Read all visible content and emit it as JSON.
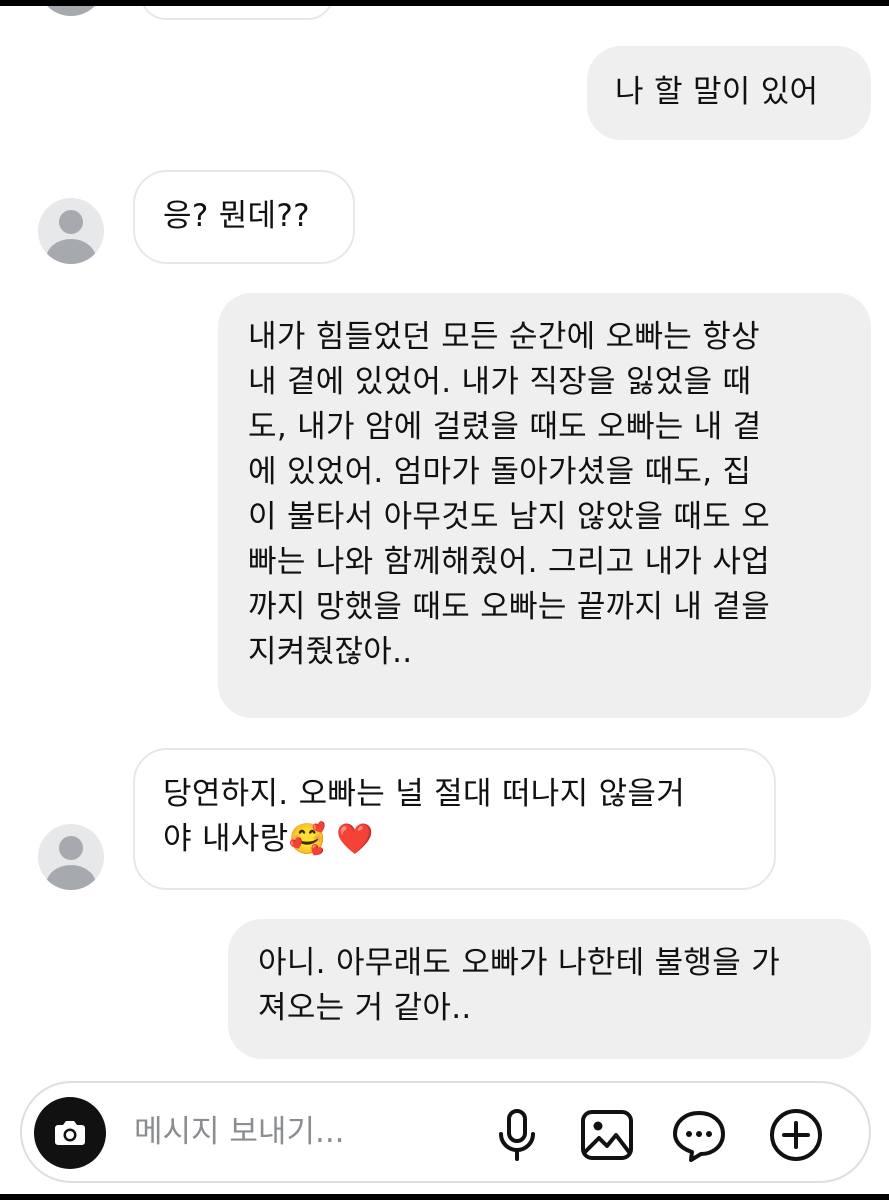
{
  "messages": [
    {
      "from": "me",
      "lines": [
        "나 할 말이 있어"
      ]
    },
    {
      "from": "them",
      "lines": [
        "응? 뭔데??"
      ]
    },
    {
      "from": "me",
      "lines": [
        "내가 힘들었던 모든 순간에 오빠는 항상",
        "내 곁에 있었어. 내가 직장을 잃었을 때",
        "도, 내가 암에 걸렸을 때도 오빠는 내 곁",
        "에 있었어. 엄마가 돌아가셨을 때도, 집",
        "이 불타서 아무것도 남지 않았을 때도 오",
        "빠는 나와 함께해줬어. 그리고 내가 사업",
        "까지 망했을 때도 오빠는 끝까지 내 곁을",
        "지켜줬잖아.."
      ]
    },
    {
      "from": "them",
      "lines": [
        "당연하지. 오빠는 널 절대 떠나지 않을거",
        "야 내사랑"
      ],
      "emoji": [
        "🥰",
        "❤️"
      ]
    },
    {
      "from": "me",
      "lines": [
        "아니. 아무래도 오빠가 나한테 불행을 가",
        "져오는 거 같아.."
      ]
    }
  ],
  "composer": {
    "placeholder": "메시지 보내기...",
    "icons": [
      "camera-icon",
      "microphone-icon",
      "image-icon",
      "sticker-chat-icon",
      "plus-circle-icon"
    ]
  }
}
